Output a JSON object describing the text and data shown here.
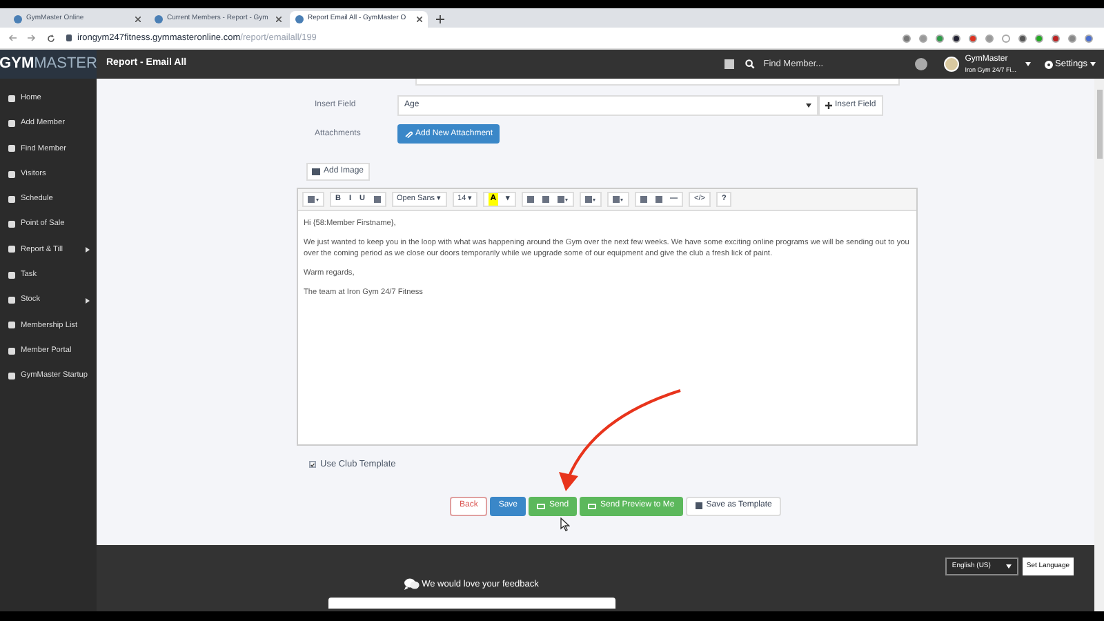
{
  "browser": {
    "tabs": [
      {
        "title": "GymMaster Online",
        "selected": false
      },
      {
        "title": "Current Members - Report - Gym",
        "selected": false
      },
      {
        "title": "Report Email All - GymMaster O",
        "selected": true
      }
    ],
    "url_host": "irongym247fitness.gymmasteronline.com",
    "url_path": "/report/emailall/199"
  },
  "app": {
    "logo_bold": "GYM",
    "logo_light": "MASTER",
    "page_title": "Report - Email All",
    "search": {
      "placeholder": "Find Member..."
    },
    "user": {
      "name": "GymMaster",
      "gym": "Iron Gym 24/7 Fi..."
    },
    "settings": "Settings"
  },
  "sidebar": {
    "items": [
      {
        "label": "Home",
        "submenu": false
      },
      {
        "label": "Add Member",
        "submenu": false
      },
      {
        "label": "Find Member",
        "submenu": false
      },
      {
        "label": "Visitors",
        "submenu": false
      },
      {
        "label": "Schedule",
        "submenu": false
      },
      {
        "label": "Point of Sale",
        "submenu": false
      },
      {
        "label": "Report & Till",
        "submenu": true
      },
      {
        "label": "Task",
        "submenu": false
      },
      {
        "label": "Stock",
        "submenu": true
      },
      {
        "label": "Membership List",
        "submenu": false
      },
      {
        "label": "Member Portal",
        "submenu": false
      },
      {
        "label": "GymMaster Startup",
        "submenu": false
      }
    ]
  },
  "form": {
    "insert_field_label": "Insert Field",
    "insert_field_value": "Age",
    "insert_field_button": "Insert Field",
    "attachments_label": "Attachments",
    "attachment_button": "Add New Attachment",
    "add_image": "Add Image"
  },
  "toolbar": [
    [
      {
        "kind": "icon",
        "caret": "▾"
      }
    ],
    [
      {
        "kind": "text",
        "label": "B"
      },
      {
        "kind": "text",
        "label": "I"
      },
      {
        "kind": "text",
        "label": "U"
      },
      {
        "kind": "icon"
      }
    ],
    [
      {
        "kind": "text",
        "label": "Open Sans ▾"
      }
    ],
    [
      {
        "kind": "text",
        "label": "14 ▾"
      }
    ],
    [
      {
        "kind": "color",
        "label": "A"
      },
      {
        "kind": "text",
        "label": "▾"
      }
    ],
    [
      {
        "kind": "icon"
      },
      {
        "kind": "icon"
      },
      {
        "kind": "icon",
        "caret": "▾"
      }
    ],
    [
      {
        "kind": "icon",
        "caret": "▾"
      }
    ],
    [
      {
        "kind": "icon",
        "caret": "▾"
      }
    ],
    [
      {
        "kind": "icon"
      },
      {
        "kind": "icon"
      },
      {
        "kind": "text",
        "label": "—"
      }
    ],
    [
      {
        "kind": "text",
        "label": "</>"
      }
    ],
    [
      {
        "kind": "text",
        "label": "?"
      }
    ]
  ],
  "email_body": [
    "Hi {58:Member Firstname},",
    "We just wanted to keep you in the loop with what was happening around the Gym over the next few weeks. We have some exciting online programs we will be sending out to you over the coming period as we close our doors temporarily while we upgrade some of our equipment and give the club a fresh lick of paint.",
    "Warm regards,",
    "The team at Iron Gym 24/7 Fitness"
  ],
  "use_club_template": {
    "label": "Use Club Template",
    "checked": true
  },
  "actions": [
    {
      "label": "Back",
      "kind": "back"
    },
    {
      "label": "Save",
      "kind": "primary"
    },
    {
      "label": "Send",
      "kind": "success"
    },
    {
      "label": "Send Preview to Me",
      "kind": "success"
    },
    {
      "label": "Save as Template",
      "kind": "default"
    }
  ],
  "footer": {
    "language": "English (US)",
    "set_language": "Set Language",
    "feedback": "We would love your feedback"
  }
}
